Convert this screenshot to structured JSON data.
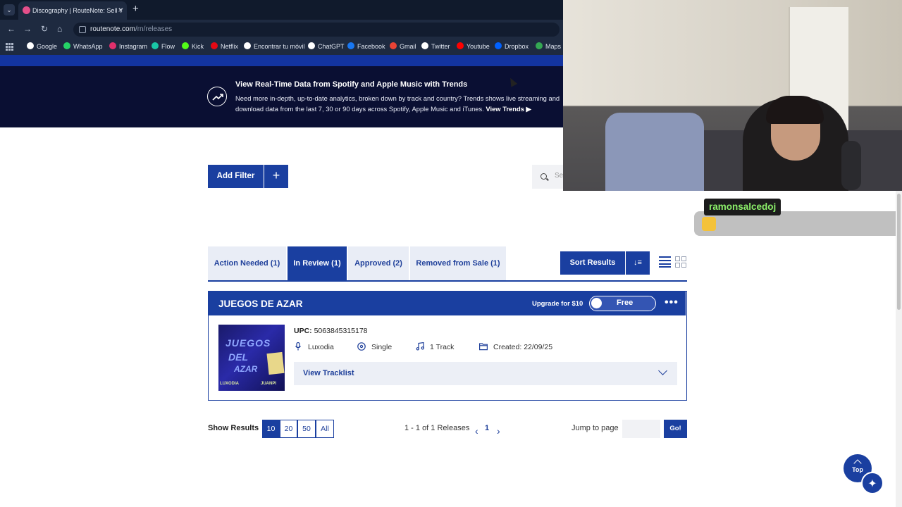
{
  "browser": {
    "tab_title": "Discography | RouteNote: Sell Y",
    "url_domain": "routenote.com",
    "url_path": "/rn/releases",
    "bookmarks": [
      {
        "label": "Google",
        "color": "#ffffff"
      },
      {
        "label": "WhatsApp",
        "color": "#25d366"
      },
      {
        "label": "Instagram",
        "color": "#e1306c"
      },
      {
        "label": "Flow",
        "color": "#19c6a6"
      },
      {
        "label": "Kick",
        "color": "#53fc18"
      },
      {
        "label": "Netflix",
        "color": "#e50914"
      },
      {
        "label": "Encontrar tu móvil",
        "color": "#ffffff"
      },
      {
        "label": "ChatGPT",
        "color": "#ffffff"
      },
      {
        "label": "Facebook",
        "color": "#1877f2"
      },
      {
        "label": "Gmail",
        "color": "#ea4335"
      },
      {
        "label": "Twitter",
        "color": "#ffffff"
      },
      {
        "label": "Youtube",
        "color": "#ff0000"
      },
      {
        "label": "Dropbox",
        "color": "#0061ff"
      },
      {
        "label": "Maps",
        "color": "#34a853"
      }
    ]
  },
  "banner": {
    "title": "View Real-Time Data from Spotify and Apple Music with Trends",
    "description": "Need more in-depth, up-to-date analytics, broken down by track and country? Trends shows live streaming and download data from the last 7, 30 or 90 days across Spotify, Apple Music and iTunes.",
    "link": "View Trends ▶"
  },
  "filter": {
    "add_filter": "Add Filter",
    "plus": "+",
    "search_placeholder": "Se"
  },
  "tabs": [
    {
      "label": "Action Needed (1)"
    },
    {
      "label": "In Review (1)"
    },
    {
      "label": "Approved (2)"
    },
    {
      "label": "Removed from Sale (1)"
    }
  ],
  "sort": {
    "label": "Sort Results",
    "dir_icon": "↓≡"
  },
  "release": {
    "title": "JUEGOS DE AZAR",
    "upgrade": "Upgrade for $10",
    "plan": "Free",
    "menu": "•••",
    "upc_label": "UPC:",
    "upc": "5063845315178",
    "artist": "Luxodia",
    "type": "Single",
    "tracks": "1 Track",
    "created": "Created: 22/09/25",
    "view_tracklist": "View Tracklist",
    "cover_text": [
      "JUEGOS",
      "DEL",
      "AZAR"
    ],
    "cover_credit_left": "LUXODIA",
    "cover_credit_right": "JUANPI"
  },
  "pagination": {
    "show_results": "Show Results",
    "sizes": [
      "10",
      "20",
      "50",
      "All"
    ],
    "range": "1 - 1 of 1 Releases",
    "page": "1",
    "jump_label": "Jump to page",
    "go": "Go!"
  },
  "floating": {
    "top": "Top",
    "assistant_icon": "✦"
  },
  "overlay": {
    "chat_name": "ramonsalcedoj"
  },
  "colors": {
    "brand_blue": "#1a3fa0",
    "banner_bg": "#0a0f33",
    "chat_name": "#8cf06a"
  }
}
